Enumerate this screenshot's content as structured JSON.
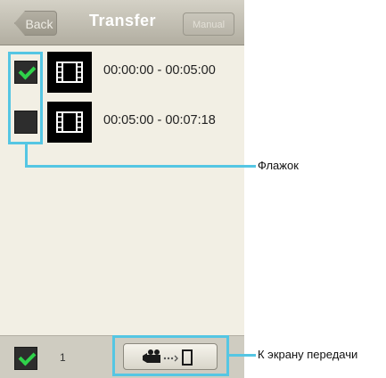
{
  "header": {
    "back_label": "Back",
    "title": "Transfer",
    "manual_label": "Manual"
  },
  "clips": [
    {
      "checked": true,
      "range": "00:00:00 - 00:05:00"
    },
    {
      "checked": false,
      "range": "00:05:00 - 00:07:18"
    }
  ],
  "footer": {
    "select_all_checked": true,
    "selected_count": "1"
  },
  "annotations": {
    "checkbox_label": "Флажок",
    "transfer_label": "К экрану передачи"
  },
  "icons": {
    "thumb": "film-icon",
    "transfer": "camera-to-phone-icon",
    "check": "checkmark-icon"
  },
  "colors": {
    "callout": "#55c6e3",
    "checkmark": "#2fd24a",
    "titlebar": "#b2aea1",
    "background": "#f2efe4"
  }
}
